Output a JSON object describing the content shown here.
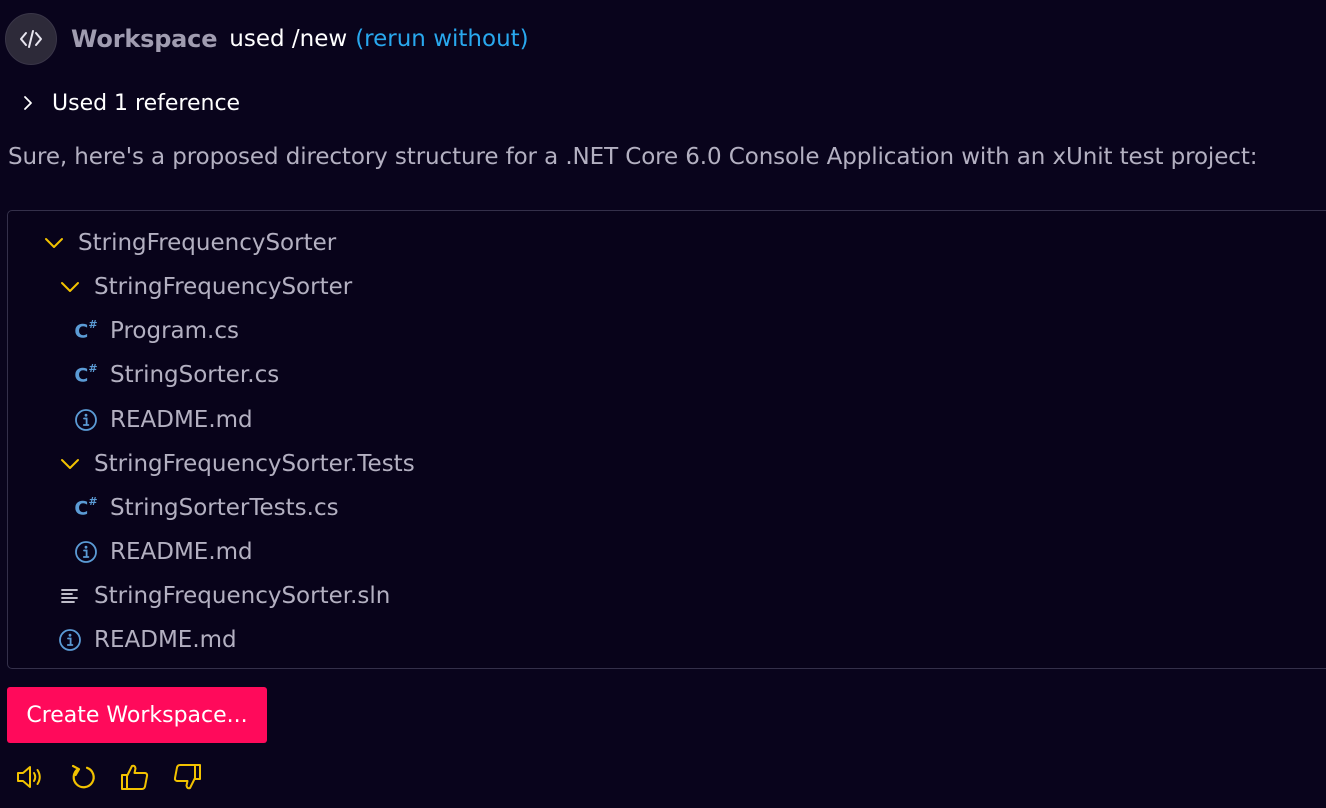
{
  "header": {
    "avatar_icon": "code-brackets-icon",
    "workspace_name": "Workspace",
    "used_command": "used /new",
    "rerun_link": "(rerun without)",
    "link_color": "#29a8ee"
  },
  "references": {
    "label": "Used 1 reference",
    "icon": "chevron-right-icon"
  },
  "intro_text": "Sure, here's a proposed directory structure for a .NET Core 6.0 Console Application with an xUnit test project:",
  "tree": {
    "items": [
      {
        "name": "StringFrequencySorter",
        "icon": "folder-chevron-down-icon",
        "depth": 0
      },
      {
        "name": "StringFrequencySorter",
        "icon": "folder-chevron-down-icon",
        "depth": 1
      },
      {
        "name": "Program.cs",
        "icon": "csharp-file-icon",
        "depth": 2
      },
      {
        "name": "StringSorter.cs",
        "icon": "csharp-file-icon",
        "depth": 2
      },
      {
        "name": "README.md",
        "icon": "info-icon",
        "depth": 2
      },
      {
        "name": "StringFrequencySorter.Tests",
        "icon": "folder-chevron-down-icon",
        "depth": 1
      },
      {
        "name": "StringSorterTests.cs",
        "icon": "csharp-file-icon",
        "depth": 2
      },
      {
        "name": "README.md",
        "icon": "info-icon",
        "depth": 2
      },
      {
        "name": "StringFrequencySorter.sln",
        "icon": "solution-file-icon",
        "depth": 1
      },
      {
        "name": "README.md",
        "icon": "info-icon",
        "depth": 1
      }
    ]
  },
  "create_button": {
    "label": "Create Workspace...",
    "color": "#ff0a5b"
  },
  "actions": [
    {
      "icon": "speaker-icon"
    },
    {
      "icon": "refresh-icon"
    },
    {
      "icon": "thumbs-up-icon"
    },
    {
      "icon": "thumbs-down-icon"
    }
  ],
  "colors": {
    "background": "#09041c",
    "accent_yellow": "#f2c200",
    "file_icon_blue": "#5b9bd5"
  }
}
